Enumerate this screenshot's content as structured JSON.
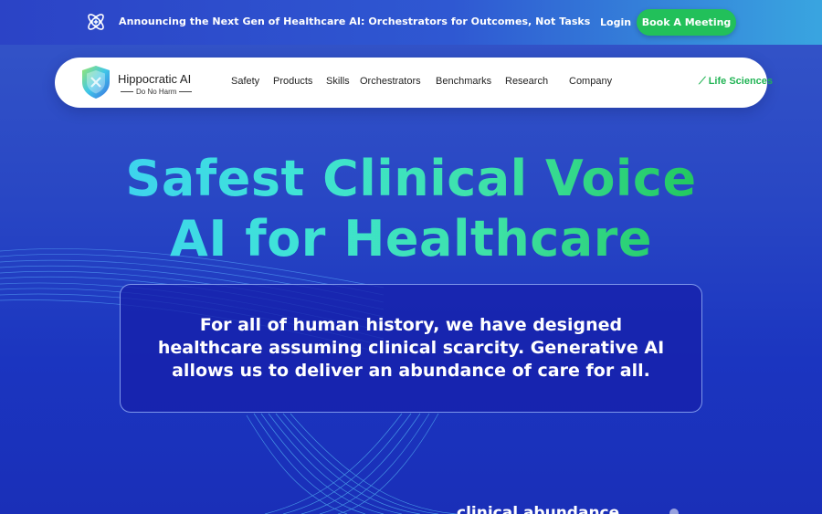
{
  "announcement": {
    "icon": "atom-cross-icon",
    "text": "Announcing the Next Gen of Healthcare AI: Orchestrators for Outcomes, Not Tasks",
    "login_label": "Login",
    "cta_label": "Book A Meeting"
  },
  "nav": {
    "brand_name": "Hippocratic AI",
    "brand_tagline": "Do No Harm",
    "items": [
      "Safety",
      "Products",
      "Skills",
      "Orchestrators",
      "Benchmarks",
      "Research",
      "Company"
    ],
    "life_sciences_label": "Life Sciences"
  },
  "hero": {
    "title_line1": "Safest Clinical Voice",
    "title_line2": "AI for Healthcare",
    "quote": "For all of human history, we have designed healthcare assuming clinical scarcity. Generative AI allows us to deliver an abundance of care for all."
  },
  "below_fold": {
    "partial_text": "clinical abundance"
  },
  "colors": {
    "accent_green": "#22c05a",
    "brand_blue": "#2846c4",
    "title_gradient_start": "#3cc8ff",
    "title_gradient_end": "#1fbf55"
  }
}
